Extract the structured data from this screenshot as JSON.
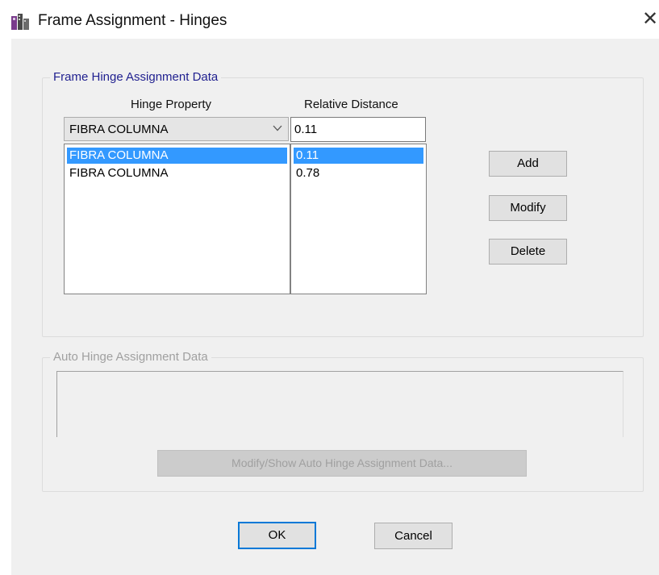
{
  "window": {
    "title": "Frame Assignment - Hinges",
    "close_glyph": "✕",
    "icon": "app-icon"
  },
  "frame_hinge": {
    "group_title": "Frame Hinge Assignment Data",
    "col_hinge_property": "Hinge Property",
    "col_relative_distance": "Relative Distance",
    "combo_value": "FIBRA COLUMNA",
    "distance_value": "0.11",
    "hinge_list": [
      {
        "label": "FIBRA COLUMNA",
        "selected": true
      },
      {
        "label": "FIBRA COLUMNA",
        "selected": false
      }
    ],
    "distance_list": [
      {
        "label": "0.11",
        "selected": true
      },
      {
        "label": "0.78",
        "selected": false
      }
    ],
    "buttons": {
      "add": "Add",
      "modify": "Modify",
      "delete": "Delete"
    }
  },
  "auto_hinge": {
    "group_title": "Auto Hinge Assignment Data",
    "info_text": "",
    "modify_show_button": "Modify/Show Auto Hinge Assignment Data..."
  },
  "footer": {
    "ok": "OK",
    "cancel": "Cancel"
  },
  "colors": {
    "selection": "#3399ff",
    "default_button_border": "#0078d7",
    "group_caption_active": "#1f1f8f",
    "disabled_text": "#a0a0a0"
  }
}
